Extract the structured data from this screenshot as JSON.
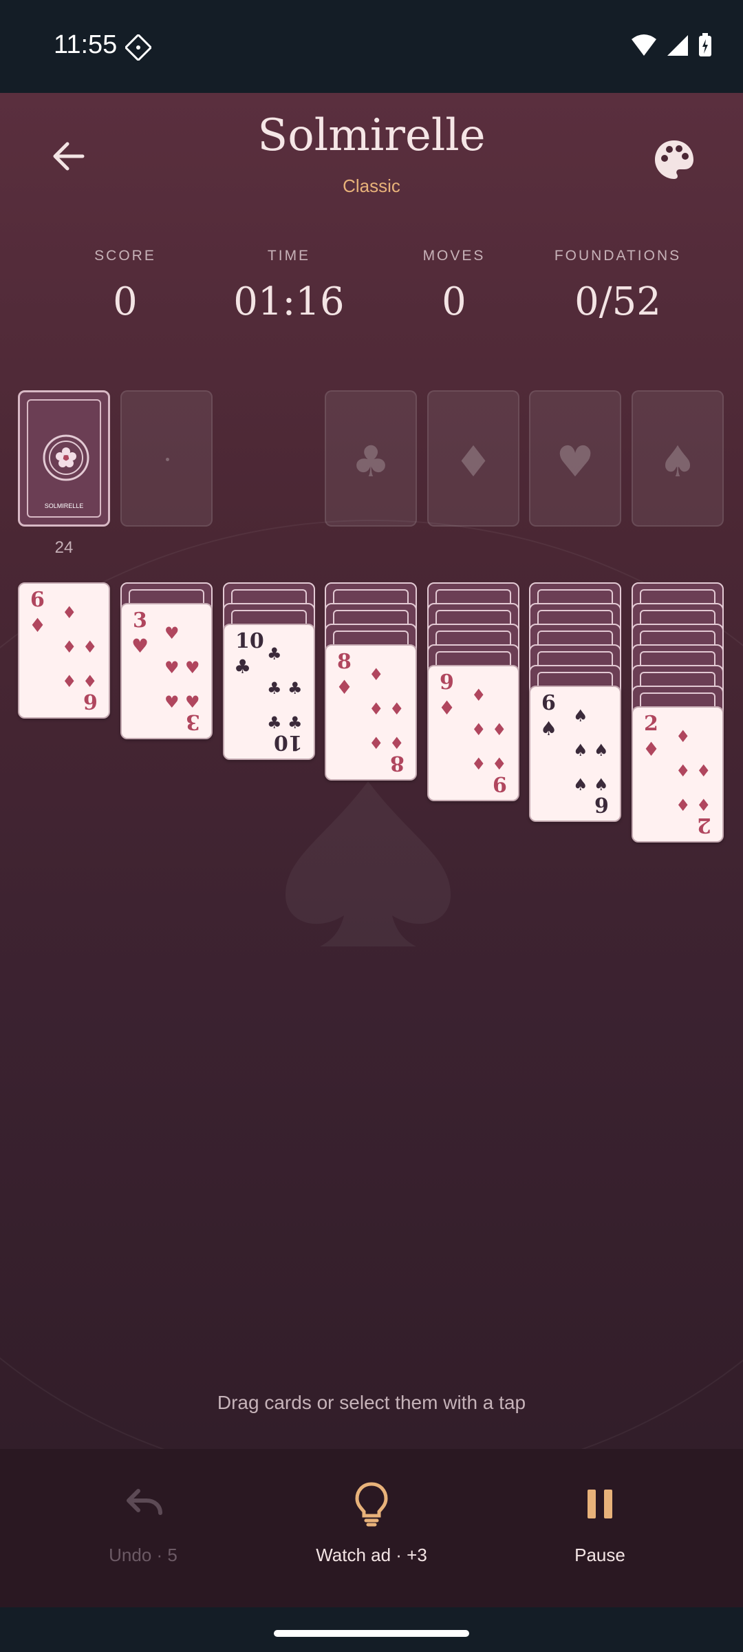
{
  "status_bar": {
    "time": "11:55"
  },
  "header": {
    "title": "Solmirelle",
    "subtitle": "Classic"
  },
  "stats": [
    {
      "label": "SCORE",
      "value": "0"
    },
    {
      "label": "TIME",
      "value": "01:16"
    },
    {
      "label": "MOVES",
      "value": "0"
    },
    {
      "label": "FOUNDATIONS",
      "value": "0/52"
    }
  ],
  "stock": {
    "count": "24",
    "back_label": "SOLMIRELLE"
  },
  "foundations": [
    "♣",
    "♦",
    "♥",
    "♠"
  ],
  "tableau": [
    {
      "hidden": 0,
      "rank": "6",
      "suit": "♦",
      "color": "red"
    },
    {
      "hidden": 1,
      "rank": "3",
      "suit": "♥",
      "color": "red"
    },
    {
      "hidden": 2,
      "rank": "10",
      "suit": "♣",
      "color": "black"
    },
    {
      "hidden": 3,
      "rank": "8",
      "suit": "♦",
      "color": "red"
    },
    {
      "hidden": 4,
      "rank": "9",
      "suit": "♦",
      "color": "red"
    },
    {
      "hidden": 5,
      "rank": "6",
      "suit": "♠",
      "color": "black"
    },
    {
      "hidden": 6,
      "rank": "2",
      "suit": "♦",
      "color": "red"
    }
  ],
  "hint": "Drag cards or select them with a tap",
  "actions": {
    "undo": "Undo · 5",
    "watch_ad": "Watch ad · +3",
    "pause": "Pause"
  },
  "colors": {
    "accent": "#e8b27a",
    "card_red": "#b0465e",
    "card_black": "#3b2a3a"
  }
}
